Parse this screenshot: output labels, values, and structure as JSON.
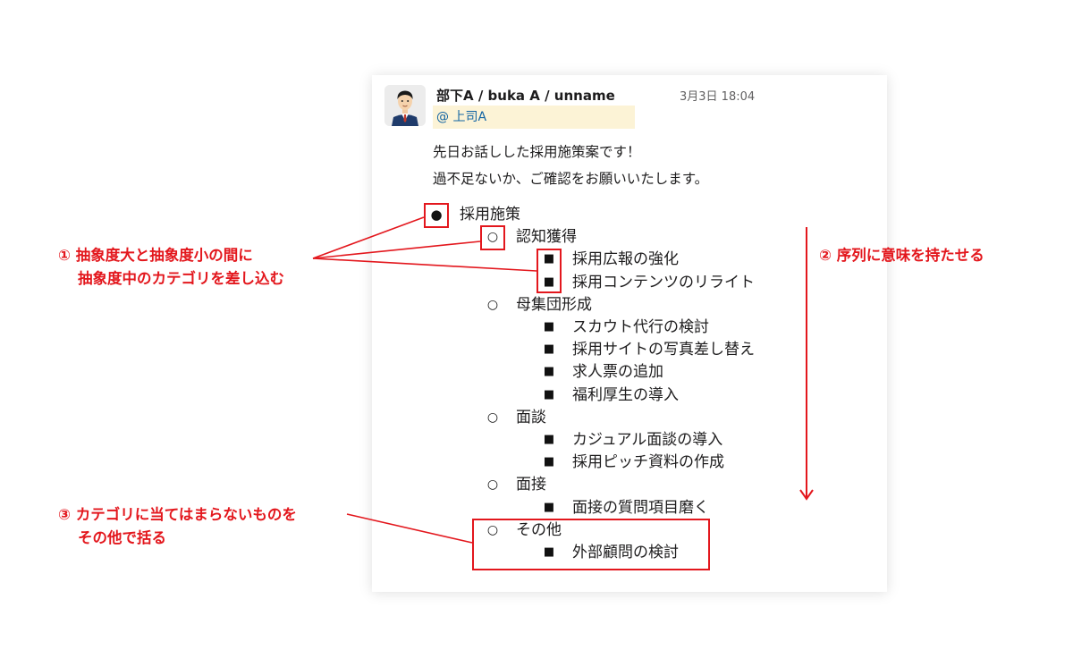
{
  "message": {
    "sender": "部下A / buka A / unname",
    "timestamp": "3月3日 18:04",
    "mention": "@ 上司A",
    "lines": [
      "先日お話しした採用施策案です！",
      "過不足ないか、ご確認をお願いいたします。"
    ]
  },
  "outline": {
    "bullet_glyphs": {
      "level1": "●",
      "level2": "○",
      "level3": "■"
    },
    "items": [
      {
        "level": 1,
        "text": "採用施策"
      },
      {
        "level": 2,
        "text": "認知獲得"
      },
      {
        "level": 3,
        "text": "採用広報の強化"
      },
      {
        "level": 3,
        "text": "採用コンテンツのリライト"
      },
      {
        "level": 2,
        "text": "母集団形成"
      },
      {
        "level": 3,
        "text": "スカウト代行の検討"
      },
      {
        "level": 3,
        "text": "採用サイトの写真差し替え"
      },
      {
        "level": 3,
        "text": "求人票の追加"
      },
      {
        "level": 3,
        "text": "福利厚生の導入"
      },
      {
        "level": 2,
        "text": "面談"
      },
      {
        "level": 3,
        "text": "カジュアル面談の導入"
      },
      {
        "level": 3,
        "text": "採用ピッチ資料の作成"
      },
      {
        "level": 2,
        "text": "面接"
      },
      {
        "level": 3,
        "text": "面接の質問項目磨く"
      },
      {
        "level": 2,
        "text": "その他"
      },
      {
        "level": 3,
        "text": "外部顧問の検討"
      }
    ]
  },
  "annotations": {
    "note1": {
      "line1": "① 抽象度大と抽象度小の間に",
      "line2": "抽象度中のカテゴリを差し込む"
    },
    "note2": {
      "line1": "② 序列に意味を持たせる"
    },
    "note3": {
      "line1": "③ カテゴリに当てはまらないものを",
      "line2": "その他で括る"
    }
  },
  "colors": {
    "annotation_red": "#e3171d",
    "mention_bg": "#fcf3d6",
    "mention_text": "#1264a3"
  }
}
